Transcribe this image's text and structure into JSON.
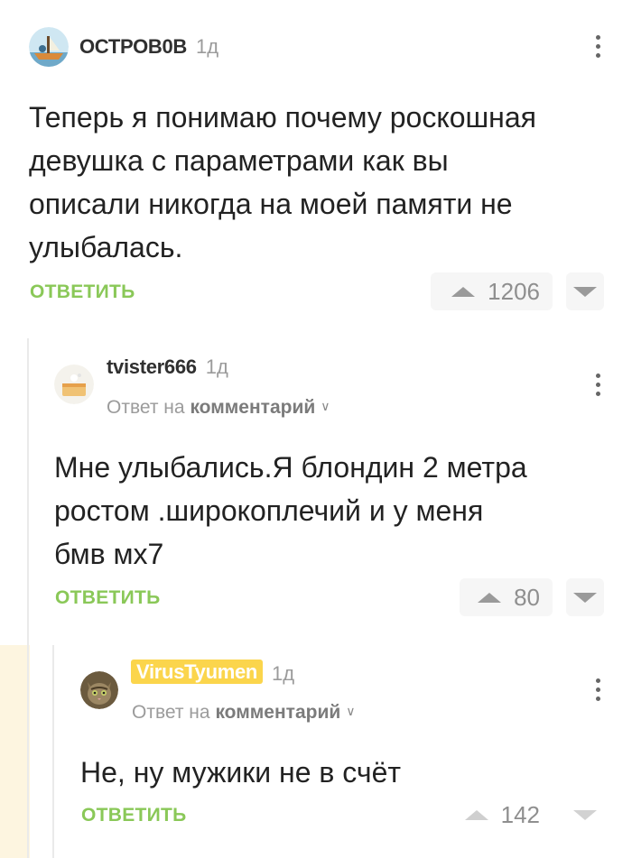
{
  "comments": [
    {
      "username": "ОСТРОВ0В",
      "time": "1д",
      "text_lines": [
        "Теперь я понимаю почему роскошная",
        "девушка с параметрами как вы",
        "описали никогда на моей памяти не",
        "улыбалась."
      ],
      "reply_label": "ОТВЕТИТЬ",
      "rating": "1206",
      "avatar_icon": "boat-avatar-icon"
    },
    {
      "username": "tvister666",
      "time": "1д",
      "reply_to_prefix": "Ответ на",
      "reply_to_target": "комментарий",
      "text_lines": [
        "Мне улыбались.Я блондин 2 метра",
        "ростом .широкоплечий и у меня",
        "бмв мх7"
      ],
      "reply_label": "ОТВЕТИТЬ",
      "rating": "80",
      "avatar_icon": "cake-avatar-icon"
    },
    {
      "username": "VirusTyumen",
      "time": "1д",
      "reply_to_prefix": "Ответ на",
      "reply_to_target": "комментарий",
      "text_lines": [
        "Не, ну мужики не в счёт"
      ],
      "reply_label": "ОТВЕТИТЬ",
      "rating": "142",
      "avatar_icon": "cat-avatar-icon",
      "username_badge_color": "#fbd54c"
    }
  ],
  "colors": {
    "reply_green": "#8ac858",
    "highlight_bg": "#fdf5e0",
    "muted_text": "#9b9b9b"
  }
}
